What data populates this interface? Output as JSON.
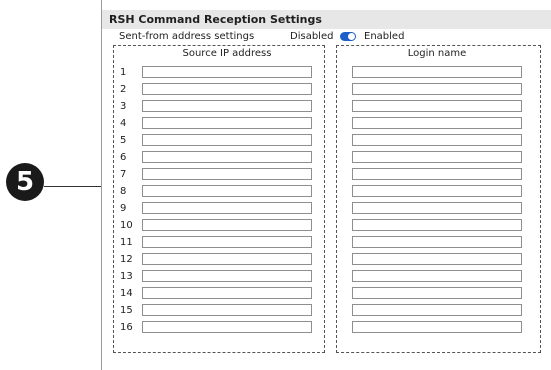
{
  "callout": {
    "number": "5"
  },
  "panel": {
    "title": "RSH Command Reception Settings",
    "sent_from_label": "Sent-from address settings",
    "toggle": {
      "off_label": "Disabled",
      "on_label": "Enabled",
      "state": "enabled",
      "color": "#1c5fc9"
    },
    "columns": {
      "ip_header": "Source IP address",
      "login_header": "Login name"
    },
    "rows": [
      {
        "num": "1",
        "ip": "",
        "login": ""
      },
      {
        "num": "2",
        "ip": "",
        "login": ""
      },
      {
        "num": "3",
        "ip": "",
        "login": ""
      },
      {
        "num": "4",
        "ip": "",
        "login": ""
      },
      {
        "num": "5",
        "ip": "",
        "login": ""
      },
      {
        "num": "6",
        "ip": "",
        "login": ""
      },
      {
        "num": "7",
        "ip": "",
        "login": ""
      },
      {
        "num": "8",
        "ip": "",
        "login": ""
      },
      {
        "num": "9",
        "ip": "",
        "login": ""
      },
      {
        "num": "10",
        "ip": "",
        "login": ""
      },
      {
        "num": "11",
        "ip": "",
        "login": ""
      },
      {
        "num": "12",
        "ip": "",
        "login": ""
      },
      {
        "num": "13",
        "ip": "",
        "login": ""
      },
      {
        "num": "14",
        "ip": "",
        "login": ""
      },
      {
        "num": "15",
        "ip": "",
        "login": ""
      },
      {
        "num": "16",
        "ip": "",
        "login": ""
      }
    ]
  }
}
